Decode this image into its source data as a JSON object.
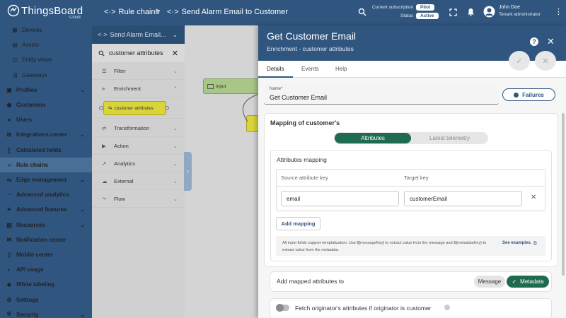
{
  "app": {
    "name": "ThingsBoard",
    "edition": "Cloud"
  },
  "header": {
    "breadcrumb": [
      "Rule chains",
      "Send Alarm Email to Customer"
    ],
    "subscription_label": "Current subscription",
    "subscription_value": "Pilot",
    "status_label": "Status",
    "status_value": "Active",
    "user_name": "John Doe",
    "user_role": "Tenant administrator"
  },
  "sidebar": {
    "items": [
      {
        "label": "Devices",
        "icon": "devices-icon",
        "sub": true
      },
      {
        "label": "Assets",
        "icon": "assets-icon",
        "sub": true
      },
      {
        "label": "Entity views",
        "icon": "entity-views-icon",
        "sub": true
      },
      {
        "label": "Gateways",
        "icon": "gateways-icon",
        "sub": true
      },
      {
        "label": "Profiles",
        "icon": "profiles-icon",
        "chevron": true
      },
      {
        "label": "Customers",
        "icon": "customers-icon"
      },
      {
        "label": "Users",
        "icon": "users-icon"
      },
      {
        "label": "Integrations center",
        "icon": "integrations-icon",
        "chevron": true
      },
      {
        "label": "Calculated fields",
        "icon": "calculated-fields-icon"
      },
      {
        "label": "Rule chains",
        "icon": "rule-chains-icon",
        "active": true
      },
      {
        "label": "Edge management",
        "icon": "edge-icon",
        "chevron": true
      },
      {
        "label": "Advanced analytics",
        "icon": "analytics-icon"
      },
      {
        "label": "Advanced features",
        "icon": "features-icon",
        "chevron": true
      },
      {
        "label": "Resources",
        "icon": "resources-icon",
        "chevron": true
      },
      {
        "label": "Notification center",
        "icon": "notification-icon"
      },
      {
        "label": "Mobile center",
        "icon": "mobile-icon"
      },
      {
        "label": "API usage",
        "icon": "api-usage-icon"
      },
      {
        "label": "White labeling",
        "icon": "white-labeling-icon"
      },
      {
        "label": "Settings",
        "icon": "settings-icon"
      },
      {
        "label": "Security",
        "icon": "security-icon",
        "chevron": true
      }
    ]
  },
  "palette": {
    "chain_title": "Send Alarm Email...",
    "search_value": "customer attributes",
    "categories": {
      "filter": "Filter",
      "enrichment": "Enrichment",
      "enrichment_node": "customer attributes",
      "transformation": "Transformation",
      "action": "Action",
      "analytics": "Analytics",
      "external": "External",
      "flow": "Flow"
    }
  },
  "canvas": {
    "input_node": "Input"
  },
  "drawer": {
    "title": "Get Customer Email",
    "subtitle": "Enrichment - customer attributes",
    "tabs": [
      "Details",
      "Events",
      "Help"
    ],
    "active_tab": "Details",
    "name_label": "Name*",
    "name_value": "Get Customer Email",
    "failures_label": "Failures",
    "mapping_title": "Mapping of customer's",
    "toggle_attributes": "Attributes",
    "toggle_telemetry": "Latest telemetry",
    "attributes_mapping_title": "Attributes mapping",
    "col_source": "Source attribute key",
    "col_target": "Target key",
    "source_value": "email",
    "target_value": "customerEmail",
    "add_mapping": "Add mapping",
    "hint_text": "All input fields support templatization. Use $[messageKey] to extract value from the message and ${metadataKey} to extract value from the metadata.",
    "see_examples": "See examples.",
    "add_mapped_to": "Add mapped attributes to",
    "opt_message": "Message",
    "opt_metadata": "Metadata",
    "fetch_label": "Fetch originator's attributes if originator is customer"
  },
  "colors": {
    "primary": "#305680",
    "accent_green": "#1f6b4f",
    "node_yellow": "#d8d43a"
  }
}
